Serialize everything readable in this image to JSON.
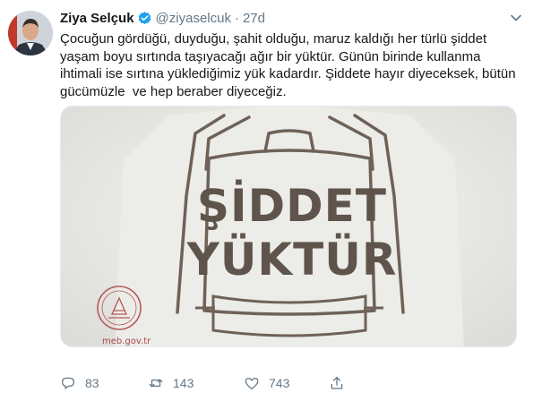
{
  "tweet": {
    "author_name": "Ziya Selçuk",
    "handle": "@ziyaselcuk",
    "separator": "·",
    "time": "27d",
    "text_lines": [
      "Çocuğun gördüğü, duyduğu, şahit olduğu, maruz kaldığı her türlü şiddet",
      "yaşam boyu sırtında taşıyacağı ağır bir yüktür. Günün birinde kullanma",
      "ihtimali ise sırtına yüklediğimiz yük kadardır. Şiddete hayır diyeceksek, bütün",
      "gücümüzle  ve hep beraber diyeceğiz."
    ],
    "media": {
      "headline_line1": "ŞİDDET",
      "headline_line2": "YÜKTÜR",
      "watermark": "meb.gov.tr"
    },
    "actions": {
      "replies": "83",
      "retweets": "143",
      "likes": "743"
    },
    "colors": {
      "verified": "#1da1f2",
      "muted": "#657786",
      "text": "#14171a"
    }
  }
}
